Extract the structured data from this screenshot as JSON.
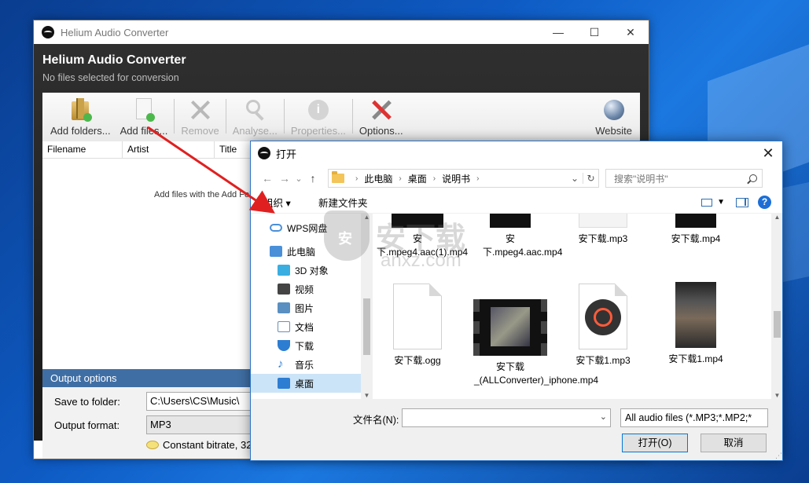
{
  "app": {
    "window_title": "Helium Audio Converter",
    "name": "Helium Audio Converter",
    "status": "No files selected for conversion",
    "controls": {
      "minimize": "—",
      "maximize": "☐",
      "close": "✕"
    },
    "toolbar": [
      {
        "label": "Add folders...",
        "icon": "add-folder-icon",
        "enabled": true
      },
      {
        "label": "Add files...",
        "icon": "add-file-icon",
        "enabled": true
      },
      {
        "label": "Remove",
        "icon": "remove-icon",
        "enabled": false
      },
      {
        "label": "Analyse...",
        "icon": "analyse-icon",
        "enabled": false
      },
      {
        "label": "Properties...",
        "icon": "info-icon",
        "enabled": false
      },
      {
        "label": "Options...",
        "icon": "tools-icon",
        "enabled": true
      },
      {
        "label": "Website",
        "icon": "globe-icon",
        "enabled": true
      }
    ],
    "columns": [
      "Filename",
      "Artist",
      "Title"
    ],
    "empty_hint": "Add files with the Add Fol",
    "output": {
      "title": "Output options",
      "save_label": "Save to folder:",
      "save_value": "C:\\Users\\CS\\Music\\",
      "format_label": "Output format:",
      "format_value": "MP3",
      "bitrate_text": "Constant bitrate, 32"
    }
  },
  "dialog": {
    "title": "打开",
    "close": "✕",
    "nav": {
      "back": "←",
      "forward": "→",
      "recent": "⌄",
      "up": "↑"
    },
    "breadcrumbs": [
      "此电脑",
      "桌面",
      "说明书"
    ],
    "refresh": "↻",
    "search_placeholder": "搜索\"说明书\"",
    "organize": "组织 ▾",
    "new_folder": "新建文件夹",
    "help": "?",
    "nav_items": [
      {
        "label": "WPS网盘",
        "icon": "cloud-icon",
        "color": "#4a90d9"
      },
      {
        "label": "此电脑",
        "icon": "computer-icon",
        "color": "#4a90d9"
      },
      {
        "label": "3D 对象",
        "icon": "cube-icon",
        "color": "#3aaee0"
      },
      {
        "label": "视频",
        "icon": "video-icon",
        "color": "#444"
      },
      {
        "label": "图片",
        "icon": "pictures-icon",
        "color": "#5a8fc2"
      },
      {
        "label": "文档",
        "icon": "documents-icon",
        "color": "#6a8fb5"
      },
      {
        "label": "下载",
        "icon": "download-icon",
        "color": "#2d7dd2"
      },
      {
        "label": "音乐",
        "icon": "music-icon",
        "color": "#2d7dd2"
      },
      {
        "label": "桌面",
        "icon": "desktop-icon",
        "color": "#2d7dd2"
      }
    ],
    "files_row1": [
      {
        "name": "安下.mpeg4.aac(1).mp4"
      },
      {
        "name": "安下.mpeg4.aac.mp4"
      },
      {
        "name": "安下载.mp3"
      },
      {
        "name": "安下载.mp4"
      }
    ],
    "files_row2": [
      {
        "name": "安下载.ogg",
        "icon": "generic-file-icon"
      },
      {
        "name": "安下载_(ALLConverter)_iphone.mp4",
        "icon": "video-file-icon"
      },
      {
        "name": "安下载1.mp3",
        "icon": "audio-file-icon"
      },
      {
        "name": "安下载1.mp4",
        "icon": "video-thumbnail-icon"
      }
    ],
    "filename_label": "文件名(N):",
    "filename_value": "",
    "filter_value": "All audio files (*.MP3;*.MP2;*",
    "open_button": "打开(O)",
    "cancel_button": "取消"
  },
  "watermark": {
    "text": "安下载",
    "sub": "anxz.com",
    "badge": "安"
  },
  "accent": {
    "arrow": "#e02020",
    "output_bar": "#3f6ea4",
    "dialog_border": "#2b73c7"
  }
}
